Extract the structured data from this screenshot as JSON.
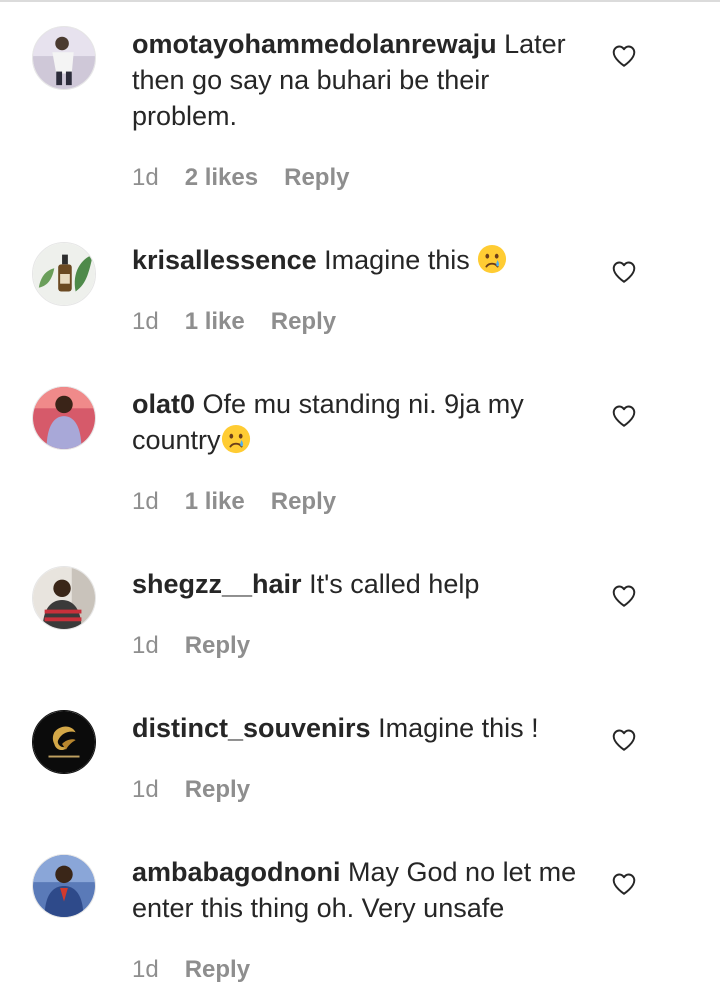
{
  "comments": [
    {
      "username": "omotayohammedolanrewaju",
      "text": "Later then go say na buhari be their problem.",
      "emoji": "",
      "time": "1d",
      "likes": "2 likes",
      "reply_label": "Reply"
    },
    {
      "username": "krisallessence",
      "text": "Imagine this",
      "emoji": "crying-face",
      "time": "1d",
      "likes": "1 like",
      "reply_label": "Reply"
    },
    {
      "username": "olat0",
      "text": "Ofe mu standing ni. 9ja my country",
      "emoji": "crying-face",
      "time": "1d",
      "likes": "1 like",
      "reply_label": "Reply"
    },
    {
      "username": "shegzz__hair",
      "text": "It's called help",
      "emoji": "",
      "time": "1d",
      "likes": "",
      "reply_label": "Reply"
    },
    {
      "username": "distinct_souvenirs",
      "text": "Imagine this !",
      "emoji": "",
      "time": "1d",
      "likes": "",
      "reply_label": "Reply"
    },
    {
      "username": "ambabagodnoni",
      "text": "May God no let me enter this thing oh. Very unsafe",
      "emoji": "",
      "time": "1d",
      "likes": "",
      "reply_label": "Reply"
    }
  ],
  "icons": {
    "like": "heart-outline-icon",
    "emoji": "crying-face-emoji"
  },
  "colors": {
    "text": "#262626",
    "meta": "#8e8e8e",
    "background": "#ffffff"
  }
}
